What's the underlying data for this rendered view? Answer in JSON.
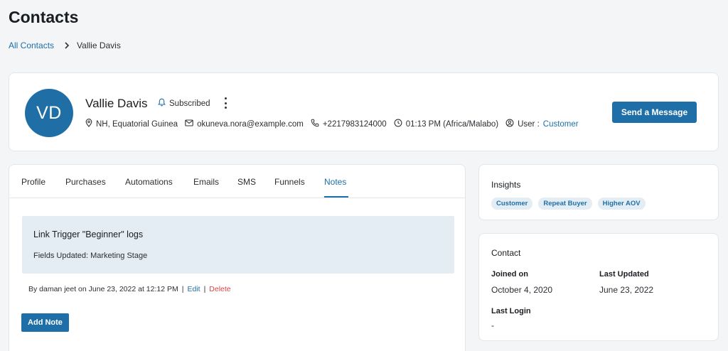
{
  "page": {
    "title": "Contacts"
  },
  "breadcrumb": {
    "parent": "All Contacts",
    "current": "Vallie Davis"
  },
  "contact": {
    "initials": "VD",
    "name": "Vallie Davis",
    "subscription_status": "Subscribed",
    "location": "NH, Equatorial Guinea",
    "email": "okuneva.nora@example.com",
    "phone": "+2217983124000",
    "local_time": "01:13 PM (Africa/Malabo)",
    "user_label": "User :",
    "user_role": "Customer",
    "send_message_label": "Send a Message",
    "avatar_color": "#1f6fa6"
  },
  "tabs": [
    {
      "label": "Profile",
      "active": false
    },
    {
      "label": "Purchases",
      "active": false
    },
    {
      "label": "Automations",
      "active": false
    },
    {
      "label": "Emails",
      "active": false
    },
    {
      "label": "SMS",
      "active": false
    },
    {
      "label": "Funnels",
      "active": false
    },
    {
      "label": "Notes",
      "active": true
    }
  ],
  "note": {
    "title": "Link Trigger \"Beginner\" logs",
    "body": "Fields Updated: Marketing Stage",
    "meta": "By daman jeet on June 23, 2022 at 12:12 PM",
    "separator": "|",
    "edit_label": "Edit",
    "delete_label": "Delete",
    "add_note_label": "Add Note"
  },
  "insights": {
    "title": "Insights",
    "tags": [
      "Customer",
      "Repeat Buyer",
      "Higher AOV"
    ]
  },
  "contact_info": {
    "title": "Contact",
    "joined_label": "Joined on",
    "joined_value": "October 4, 2020",
    "updated_label": "Last Updated",
    "updated_value": "June 23, 2022",
    "last_login_label": "Last Login",
    "last_login_value": "-"
  },
  "colors": {
    "accent": "#1e6fa8",
    "danger": "#d94545",
    "note_background": "#e4edf3"
  },
  "icons": {
    "breadcrumb_separator": "chevron-right-icon",
    "subscribed": "bell-icon",
    "location": "map-pin-icon",
    "email": "envelope-icon",
    "phone": "phone-icon",
    "time": "clock-icon",
    "user": "user-circle-icon",
    "menu": "more-vertical-icon"
  }
}
